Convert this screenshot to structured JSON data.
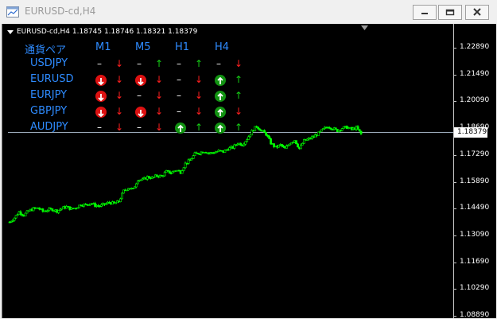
{
  "window": {
    "title": "EURUSD-cd,H4"
  },
  "chart": {
    "header": "EURUSD-cd,H4  1.18745 1.18746 1.18321 1.18379",
    "current_price": "1.18379",
    "price_labels": [
      "1.22890",
      "1.21490",
      "1.20090",
      "1.18690",
      "1.17290",
      "1.15890",
      "1.14490",
      "1.13090",
      "1.11690",
      "1.10290",
      "1.08890"
    ],
    "colors": {
      "background": "#000000",
      "candle": "#00ff00",
      "current_line": "#9aa8b8",
      "indicator_text": "#2e8bff"
    }
  },
  "indicator": {
    "title": "通貨ペア",
    "timeframes": [
      "M1",
      "M5",
      "H1",
      "H4"
    ],
    "rows": [
      {
        "pair": "USDJPY",
        "cells": [
          [
            "dash",
            "down"
          ],
          [
            "dash",
            "up"
          ],
          [
            "dash",
            "up"
          ],
          [
            "dash",
            "down"
          ]
        ]
      },
      {
        "pair": "EURUSD",
        "cells": [
          [
            "red-badge",
            "down"
          ],
          [
            "red-badge",
            "down"
          ],
          [
            "dash",
            "down"
          ],
          [
            "green-badge",
            "up"
          ]
        ]
      },
      {
        "pair": "EURJPY",
        "cells": [
          [
            "red-badge",
            "down"
          ],
          [
            "dash",
            "down"
          ],
          [
            "dash",
            "down"
          ],
          [
            "green-badge",
            "up"
          ]
        ]
      },
      {
        "pair": "GBPJPY",
        "cells": [
          [
            "red-badge",
            "down"
          ],
          [
            "red-badge",
            "down"
          ],
          [
            "dash",
            "down"
          ],
          [
            "green-badge",
            "down"
          ]
        ]
      },
      {
        "pair": "AUDJPY",
        "cells": [
          [
            "dash",
            "down"
          ],
          [
            "dash",
            "down"
          ],
          [
            "green-badge",
            "up"
          ],
          [
            "green-badge",
            "up"
          ]
        ]
      }
    ]
  },
  "chart_data": {
    "type": "candlestick",
    "symbol": "EURUSD-cd",
    "timeframe": "H4",
    "ylim": [
      1.0889,
      1.2289
    ],
    "y_ticks": [
      1.2289,
      1.2149,
      1.2009,
      1.1869,
      1.1729,
      1.1589,
      1.1449,
      1.1309,
      1.1169,
      1.1029,
      1.0889
    ],
    "series": [
      {
        "close": [
          1.1379,
          1.1401,
          1.1432,
          1.1415,
          1.1437,
          1.1448,
          1.1452,
          1.1435,
          1.1442,
          1.1445,
          1.1436,
          1.1451,
          1.1458,
          1.1446,
          1.1454,
          1.1471,
          1.1468,
          1.1478,
          1.1466,
          1.1462,
          1.1471,
          1.1481,
          1.1475,
          1.1486,
          1.1541,
          1.1558,
          1.1549,
          1.1602,
          1.1598,
          1.1614,
          1.1609,
          1.1621,
          1.1618,
          1.1642,
          1.1636,
          1.1651,
          1.164,
          1.1684,
          1.1702,
          1.1734,
          1.1741,
          1.1749,
          1.1738,
          1.1742,
          1.1749,
          1.1746,
          1.1762,
          1.1768,
          1.1791,
          1.1784,
          1.1813,
          1.1852,
          1.1879,
          1.1856,
          1.1838,
          1.1791,
          1.1768,
          1.1781,
          1.1761,
          1.1792,
          1.1807,
          1.1762,
          1.1803,
          1.1812,
          1.1825,
          1.1841,
          1.1862,
          1.1879,
          1.1868,
          1.1856,
          1.1869,
          1.1874,
          1.1862,
          1.1871,
          1.1838
        ]
      }
    ]
  }
}
